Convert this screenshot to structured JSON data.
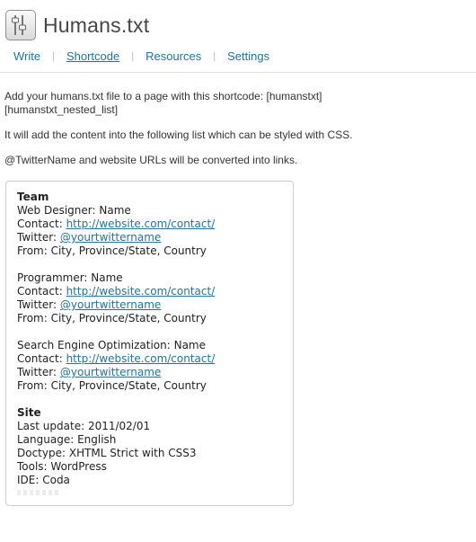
{
  "header": {
    "title": "Humans.txt",
    "icon": "sliders-icon"
  },
  "nav": {
    "tabs": [
      {
        "label": "Write",
        "current": false
      },
      {
        "label": "Shortcode",
        "current": true
      },
      {
        "label": "Resources",
        "current": false
      },
      {
        "label": "Settings",
        "current": false
      }
    ],
    "separator": "|"
  },
  "intro": {
    "line1": "Add your humans.txt file to a page with this shortcode: [humanstxt]",
    "line1b": "[humanstxt_nested_list]",
    "line2": "It will add the content into the following list which can be styled with CSS.",
    "line3": "@TwitterName and website URLs will be converted into links."
  },
  "preview": {
    "team_heading": "Team",
    "members": [
      {
        "role": "Web Designer: Name",
        "contact_label": "Contact:",
        "contact_url": "http://website.com/contact/",
        "twitter_label": "Twitter:",
        "twitter_handle": "@yourtwittername",
        "from": "From: City, Province/State, Country"
      },
      {
        "role": "Programmer: Name",
        "contact_label": "Contact:",
        "contact_url": "http://website.com/contact/",
        "twitter_label": "Twitter:",
        "twitter_handle": "@yourtwittername",
        "from": "From: City, Province/State, Country"
      },
      {
        "role": "Search Engine Optimization: Name",
        "contact_label": "Contact:",
        "contact_url": "http://website.com/contact/",
        "twitter_label": "Twitter:",
        "twitter_handle": "@yourtwittername",
        "from": "From: City, Province/State, Country"
      }
    ],
    "site_heading": "Site",
    "site_lines": [
      "Last update: 2011/02/01",
      "Language: English",
      "Doctype: XHTML Strict with CSS3",
      "Tools: WordPress",
      "IDE: Coda"
    ]
  },
  "colors": {
    "link": "#21759b",
    "text": "#333333",
    "border": "#cccccc"
  }
}
